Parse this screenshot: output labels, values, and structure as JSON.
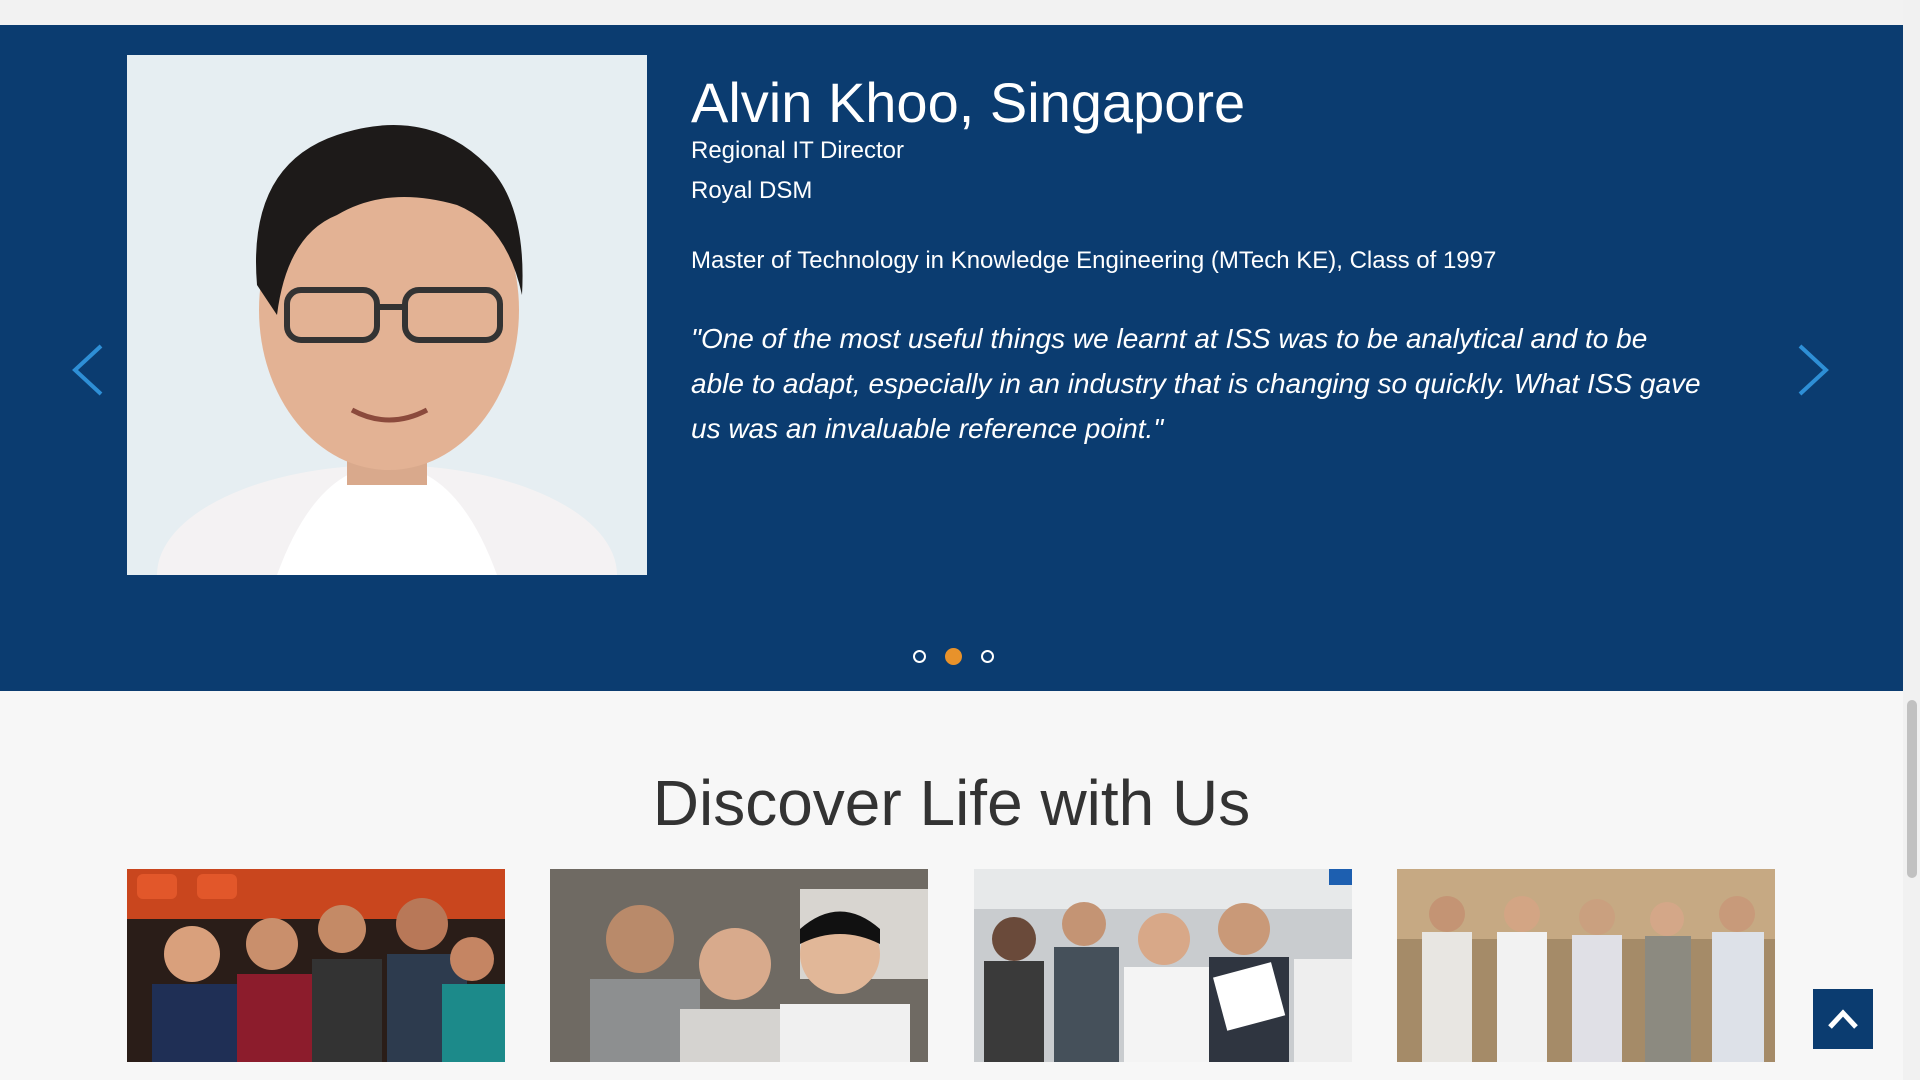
{
  "testimonial": {
    "name": "Alvin Khoo, Singapore",
    "role": "Regional IT Director",
    "company": "Royal DSM",
    "program": "Master of Technology in Knowledge Engineering (MTech KE), Class of 1997",
    "quote": "\"One of the most useful things we learnt at ISS was to be analytical and to be able to adapt, especially in an industry that is changing so quickly. What ISS gave us was an invaluable reference point.\"",
    "prev_icon": "chevron-left-icon",
    "next_icon": "chevron-right-icon",
    "dots": [
      {
        "active": false
      },
      {
        "active": true
      },
      {
        "active": false
      }
    ]
  },
  "discover": {
    "title": "Discover Life with Us"
  },
  "colors": {
    "brand_blue": "#0b3c70",
    "accent_orange": "#e8922b",
    "page_bg": "#f7f7f7"
  },
  "back_to_top_icon": "chevron-up-icon"
}
